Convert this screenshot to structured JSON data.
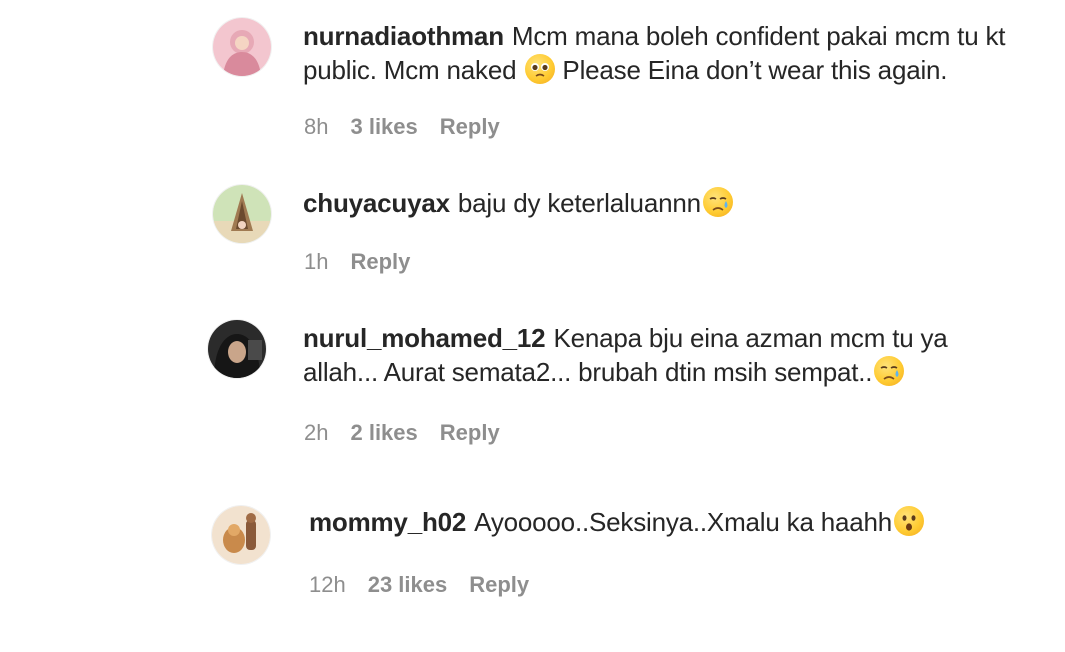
{
  "comments": [
    {
      "username": "nurnadiaothman",
      "text_before_emoji": "Mcm mana boleh confident pakai mcm tu kt public. Mcm naked",
      "emoji": "pleading-face-emoji",
      "text_after_emoji": " Please Eina don’t wear this again.",
      "time": "8h",
      "likes": "3 likes",
      "reply": "Reply"
    },
    {
      "username": "chuyacuyax",
      "text_before_emoji": "baju dy keterlaluannn",
      "emoji": "crying-face-emoji",
      "text_after_emoji": "",
      "time": "1h",
      "likes": "",
      "reply": "Reply"
    },
    {
      "username": "nurul_mohamed_12",
      "text_before_emoji": "Kenapa bju eina azman mcm tu ya allah... Aurat semata2... brubah dtin msih sempat..",
      "emoji": "crying-face-emoji",
      "text_after_emoji": "",
      "time": "2h",
      "likes": "2 likes",
      "reply": "Reply"
    },
    {
      "username": "mommy_h02",
      "text_before_emoji": "Ayooooo..Seksinya..Xmalu ka haahh",
      "emoji": "astonished-face-emoji",
      "text_after_emoji": "",
      "time": "12h",
      "likes": "23 likes",
      "reply": "Reply"
    }
  ],
  "colors": {
    "text": "#262626",
    "meta": "#8e8e8e",
    "emoji": "#ffcc33"
  }
}
